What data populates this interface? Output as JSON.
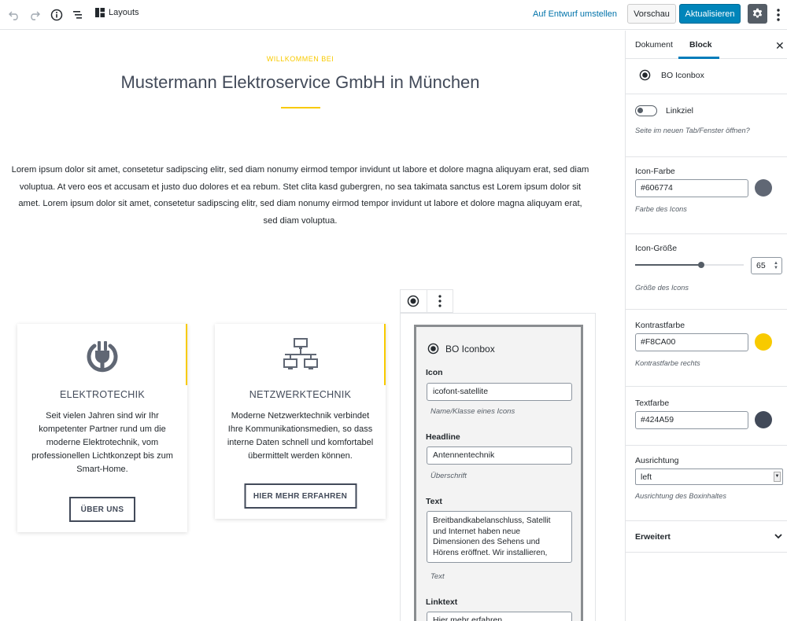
{
  "toolbar": {
    "layouts_label": "Layouts",
    "draft_link": "Auf Entwurf umstellen",
    "preview_label": "Vorschau",
    "update_label": "Aktualisieren"
  },
  "hero": {
    "eyebrow": "WILLKOMMEN BEI",
    "title": "Mustermann Elektroservice GmbH in München",
    "intro": "Lorem ipsum dolor sit amet, consetetur sadipscing elitr, sed diam nonumy eirmod tempor invidunt ut labore et dolore magna aliquyam erat, sed diam voluptua. At vero eos et accusam et justo duo dolores et ea rebum. Stet clita kasd gubergren, no sea takimata sanctus est Lorem ipsum dolor sit amet. Lorem ipsum dolor sit amet, consetetur sadipscing elitr, sed diam nonumy eirmod tempor invidunt ut labore et dolore magna aliquyam erat, sed diam voluptua."
  },
  "cards": [
    {
      "icon": "plug-icon",
      "title": "ELEKTROTECHIK",
      "text": "Seit vielen Jahren sind wir Ihr kompetenter Partner rund um die moderne Elektrotechnik, vom professionellen Lichtkonzept bis zum Smart-Home.",
      "button": "ÜBER UNS"
    },
    {
      "icon": "network-icon",
      "title": "NETZWERKTECHNIK",
      "text": "Moderne Netzwerktechnik verbindet Ihre Kommunikationsmedien, so dass interne Daten schnell und komfortabel übermittelt werden können.",
      "button": "HIER MEHR ERFAHREN"
    }
  ],
  "block": {
    "name": "BO Iconbox",
    "icon_label": "Icon",
    "icon_value": "icofont-satellite",
    "icon_help": "Name/Klasse eines Icons",
    "headline_label": "Headline",
    "headline_value": "Antennentechnik",
    "headline_help": "Überschrift",
    "text_label": "Text",
    "text_value": "Breitbandkabelanschluss, Satellit und Internet haben neue Dimensionen des Sehens und Hörens eröffnet. Wir installieren,",
    "text_help": "Text",
    "linktext_label": "Linktext",
    "linktext_value": "Hier mehr erfahren"
  },
  "sidebar": {
    "tab_document": "Dokument",
    "tab_block": "Block",
    "block_name": "BO Iconbox",
    "link_target_label": "Linkziel",
    "link_target_help": "Seite im neuen Tab/Fenster öffnen?",
    "icon_color_label": "Icon-Farbe",
    "icon_color_value": "#606774",
    "icon_color_help": "Farbe des Icons",
    "icon_size_label": "Icon-Größe",
    "icon_size_value": "65",
    "icon_size_help": "Größe des Icons",
    "contrast_label": "Kontrastfarbe",
    "contrast_value": "#F8CA00",
    "contrast_help": "Kontrastfarbe rechts",
    "text_color_label": "Textfarbe",
    "text_color_value": "#424A59",
    "alignment_label": "Ausrichtung",
    "alignment_value": "left",
    "alignment_help": "Ausrichtung des Boxinhaltes",
    "advanced_label": "Erweitert"
  },
  "colors": {
    "accent": "#F8CA00",
    "icon": "#606774",
    "text": "#424A59",
    "primary": "#0085ba"
  }
}
